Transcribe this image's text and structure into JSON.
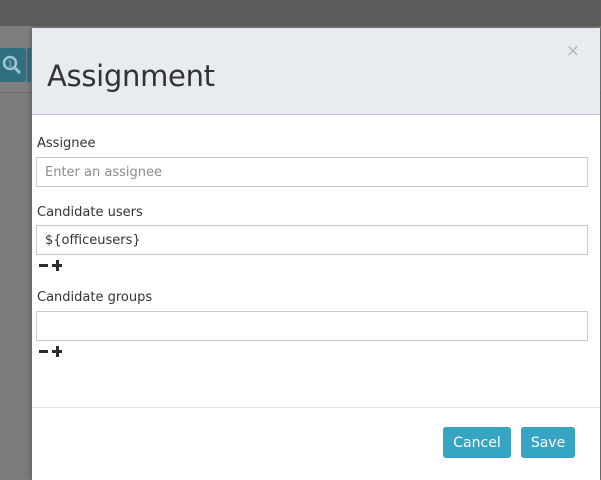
{
  "modal": {
    "title": "Assignment",
    "close_symbol": "×",
    "assignee": {
      "label": "Assignee",
      "value": "",
      "placeholder": "Enter an assignee"
    },
    "candidate_users": {
      "label": "Candidate users",
      "value": "${officeusers}",
      "placeholder": ""
    },
    "candidate_groups": {
      "label": "Candidate groups",
      "value": "",
      "placeholder": ""
    },
    "buttons": {
      "cancel": "Cancel",
      "save": "Save"
    }
  },
  "icons": {
    "remove": "minus-icon",
    "add": "plus-icon",
    "close": "close-icon",
    "zoom": "zoom-icon"
  },
  "colors": {
    "accent": "#36a5c4",
    "header_bg": "#e8ecf0",
    "overlay": "#7a7a7a"
  }
}
